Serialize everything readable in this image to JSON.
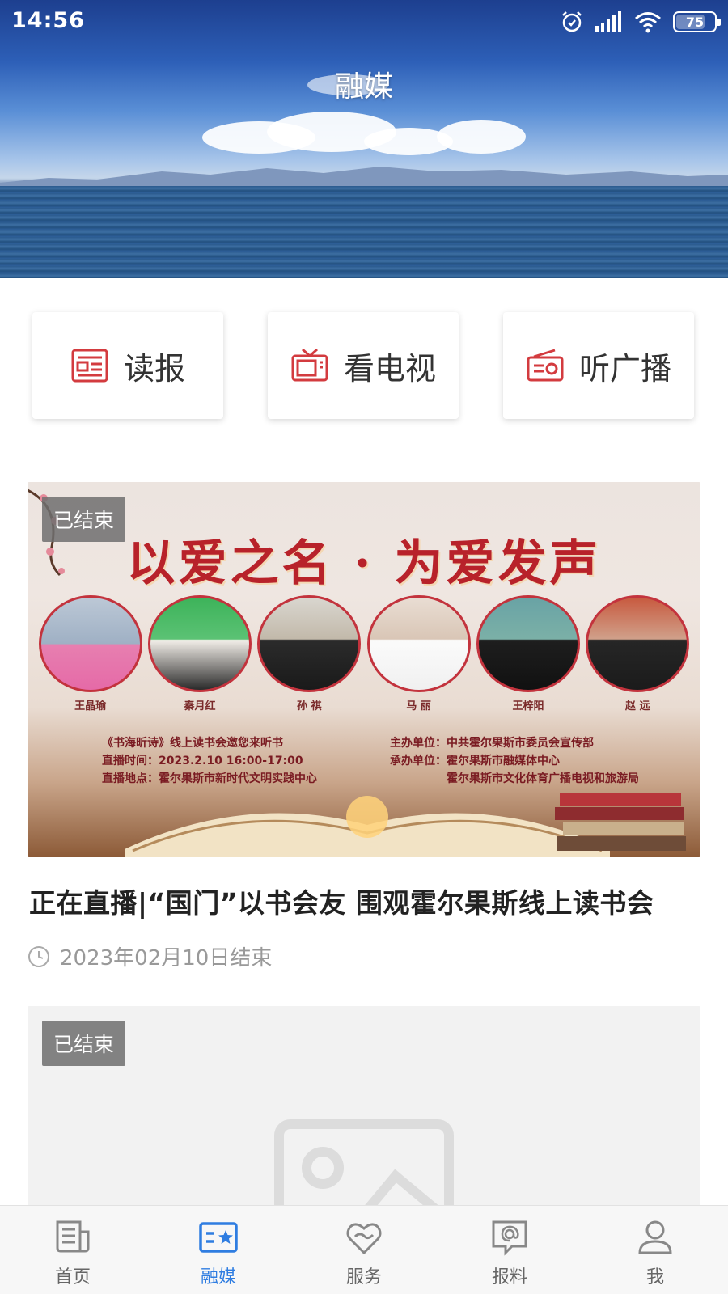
{
  "status_bar": {
    "time": "14:56",
    "battery": "75",
    "battery_level": 0.75
  },
  "header": {
    "title": "融媒"
  },
  "entries": [
    {
      "label": "读报",
      "icon": "newspaper-icon"
    },
    {
      "label": "看电视",
      "icon": "tv-icon"
    },
    {
      "label": "听广播",
      "icon": "radio-icon"
    }
  ],
  "cards": [
    {
      "badge": "已结束",
      "poster": {
        "headline": "以爱之名 · 为爱发声",
        "people": [
          "王晶瑜",
          "秦月红",
          "孙 祺",
          "马 丽",
          "王梓阳",
          "赵 远"
        ],
        "info_left": [
          "《书海昕诗》线上读书会邀您来听书",
          "直播时间：2023.2.10  16:00-17:00",
          "直播地点：霍尔果斯市新时代文明实践中心"
        ],
        "info_right": [
          "主办单位：中共霍尔果斯市委员会宣传部",
          "承办单位：霍尔果斯市融媒体中心",
          "霍尔果斯市文化体育广播电视和旅游局"
        ]
      },
      "title": "正在直播|“国门”以书会友 围观霍尔果斯线上读书会",
      "meta": "2023年02月10日结束"
    },
    {
      "badge": "已结束"
    }
  ],
  "tabbar": [
    {
      "label": "首页",
      "icon": "home-news-icon",
      "active": false
    },
    {
      "label": "融媒",
      "icon": "media-star-icon",
      "active": true
    },
    {
      "label": "服务",
      "icon": "heart-service-icon",
      "active": false
    },
    {
      "label": "报料",
      "icon": "report-at-icon",
      "active": false
    },
    {
      "label": "我",
      "icon": "user-icon",
      "active": false
    }
  ],
  "colors": {
    "accent": "#2f7de1",
    "brand_red": "#d33b3f"
  }
}
